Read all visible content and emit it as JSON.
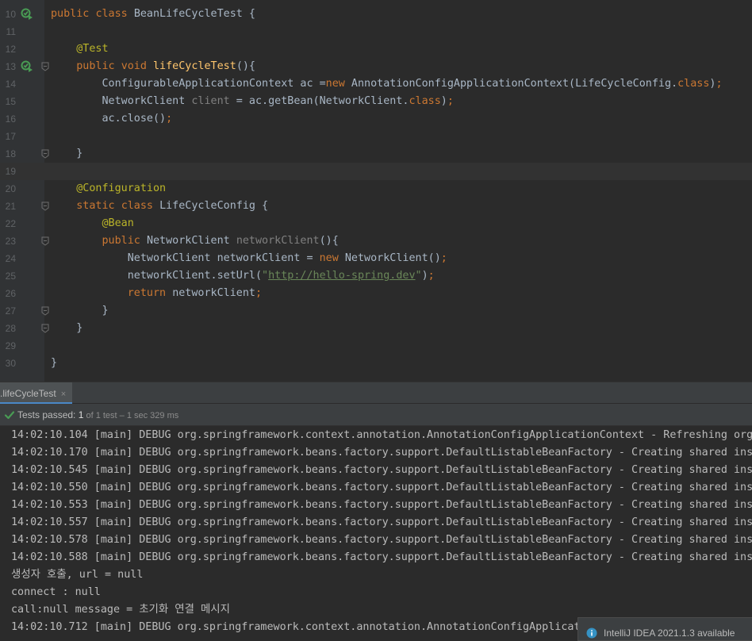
{
  "editor": {
    "lines": [
      {
        "num": "10",
        "run": true,
        "fold": false,
        "tokens": [
          [
            "k",
            "public "
          ],
          [
            "k",
            "class "
          ],
          [
            "n",
            "BeanLifeCycleTest {"
          ]
        ]
      },
      {
        "num": "11",
        "run": false,
        "fold": false,
        "tokens": []
      },
      {
        "num": "12",
        "run": false,
        "fold": false,
        "tokens": [
          [
            "n",
            "    "
          ],
          [
            "a",
            "@Test"
          ]
        ]
      },
      {
        "num": "13",
        "run": true,
        "fold": true,
        "tokens": [
          [
            "n",
            "    "
          ],
          [
            "k",
            "public "
          ],
          [
            "k",
            "void "
          ],
          [
            "f",
            "lifeCycleTest"
          ],
          [
            "n",
            "(){"
          ]
        ]
      },
      {
        "num": "14",
        "run": false,
        "fold": false,
        "tokens": [
          [
            "n",
            "        ConfigurableApplicationContext ac ="
          ],
          [
            "k",
            "new "
          ],
          [
            "n",
            "AnnotationConfigApplicationContext(LifeCycleConfig."
          ],
          [
            "k",
            "class"
          ],
          [
            "n",
            ")"
          ],
          [
            "k",
            ";"
          ]
        ]
      },
      {
        "num": "15",
        "run": false,
        "fold": false,
        "tokens": [
          [
            "n",
            "        NetworkClient "
          ],
          [
            "g",
            "client"
          ],
          [
            "n",
            " = ac.getBean(NetworkClient."
          ],
          [
            "k",
            "class"
          ],
          [
            "n",
            ")"
          ],
          [
            "k",
            ";"
          ]
        ]
      },
      {
        "num": "16",
        "run": false,
        "fold": false,
        "tokens": [
          [
            "n",
            "        ac.close()"
          ],
          [
            "k",
            ";"
          ]
        ]
      },
      {
        "num": "17",
        "run": false,
        "fold": false,
        "tokens": []
      },
      {
        "num": "18",
        "run": false,
        "fold": true,
        "tokens": [
          [
            "n",
            "    }"
          ]
        ]
      },
      {
        "num": "19",
        "run": false,
        "fold": false,
        "current": true,
        "tokens": []
      },
      {
        "num": "20",
        "run": false,
        "fold": false,
        "tokens": [
          [
            "n",
            "    "
          ],
          [
            "a",
            "@Configuration"
          ]
        ]
      },
      {
        "num": "21",
        "run": false,
        "fold": true,
        "tokens": [
          [
            "n",
            "    "
          ],
          [
            "k",
            "static "
          ],
          [
            "k",
            "class "
          ],
          [
            "n",
            "LifeCycleConfig {"
          ]
        ]
      },
      {
        "num": "22",
        "run": false,
        "fold": false,
        "tokens": [
          [
            "n",
            "        "
          ],
          [
            "a",
            "@Bean"
          ]
        ]
      },
      {
        "num": "23",
        "run": false,
        "fold": true,
        "tokens": [
          [
            "n",
            "        "
          ],
          [
            "k",
            "public "
          ],
          [
            "n",
            "NetworkClient "
          ],
          [
            "g",
            "networkClient"
          ],
          [
            "n",
            "(){"
          ]
        ]
      },
      {
        "num": "24",
        "run": false,
        "fold": false,
        "tokens": [
          [
            "n",
            "            NetworkClient networkClient = "
          ],
          [
            "k",
            "new "
          ],
          [
            "n",
            "NetworkClient()"
          ],
          [
            "k",
            ";"
          ]
        ]
      },
      {
        "num": "25",
        "run": false,
        "fold": false,
        "tokens": [
          [
            "n",
            "            networkClient.setUrl("
          ],
          [
            "s",
            "\""
          ],
          [
            "u",
            "http://hello-spring.dev"
          ],
          [
            "s",
            "\""
          ],
          [
            "n",
            ")"
          ],
          [
            "k",
            ";"
          ]
        ]
      },
      {
        "num": "26",
        "run": false,
        "fold": false,
        "tokens": [
          [
            "n",
            "            "
          ],
          [
            "k",
            "return "
          ],
          [
            "n",
            "networkClient"
          ],
          [
            "k",
            ";"
          ]
        ]
      },
      {
        "num": "27",
        "run": false,
        "fold": true,
        "tokens": [
          [
            "n",
            "        }"
          ]
        ]
      },
      {
        "num": "28",
        "run": false,
        "fold": true,
        "tokens": [
          [
            "n",
            "    }"
          ]
        ]
      },
      {
        "num": "29",
        "run": false,
        "fold": false,
        "tokens": []
      },
      {
        "num": "30",
        "run": false,
        "fold": false,
        "tokens": [
          [
            "n",
            "}"
          ]
        ]
      }
    ]
  },
  "run_panel": {
    "tab_label": ".lifeCycleTest",
    "tab_close": "×",
    "status": {
      "prefix": "Tests passed: ",
      "passed": "1",
      "detail": " of 1 test – 1 sec 329 ms"
    },
    "console_lines": [
      "14:02:10.104 [main] DEBUG org.springframework.context.annotation.AnnotationConfigApplicationContext - Refreshing org.",
      "14:02:10.170 [main] DEBUG org.springframework.beans.factory.support.DefaultListableBeanFactory - Creating shared inst",
      "14:02:10.545 [main] DEBUG org.springframework.beans.factory.support.DefaultListableBeanFactory - Creating shared inst",
      "14:02:10.550 [main] DEBUG org.springframework.beans.factory.support.DefaultListableBeanFactory - Creating shared inst",
      "14:02:10.553 [main] DEBUG org.springframework.beans.factory.support.DefaultListableBeanFactory - Creating shared inst",
      "14:02:10.557 [main] DEBUG org.springframework.beans.factory.support.DefaultListableBeanFactory - Creating shared inst",
      "14:02:10.578 [main] DEBUG org.springframework.beans.factory.support.DefaultListableBeanFactory - Creating shared inst",
      "14:02:10.588 [main] DEBUG org.springframework.beans.factory.support.DefaultListableBeanFactory - Creating shared inst",
      "생성자 호출, url = null",
      "connect : null",
      "call:null message = 초기화 연결 메시지",
      "14:02:10.712 [main] DEBUG org.springframework.context.annotation.AnnotationConfigApplicat"
    ]
  },
  "notification": {
    "text": "IntelliJ IDEA 2021.1.3 available",
    "icon": "info-icon"
  },
  "colors": {
    "keyword": "#cc7832",
    "annotation": "#bbb529",
    "method": "#ffc66d",
    "string": "#6a8759",
    "unused": "#808080",
    "default": "#a9b7c6",
    "pass_green": "#499c54"
  }
}
